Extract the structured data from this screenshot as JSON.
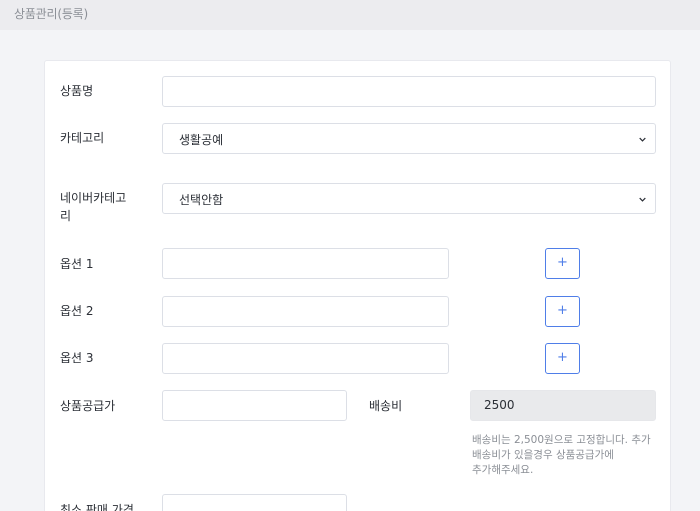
{
  "header": {
    "title": "상품관리(등록)"
  },
  "form": {
    "product_name": {
      "label": "상품명",
      "value": ""
    },
    "category": {
      "label": "카테고리",
      "selected": "생활공예"
    },
    "naver_category": {
      "label_line1": "네이버카테고",
      "label_line2": "리",
      "selected": "선택안함"
    },
    "options": [
      {
        "label": "옵션 1",
        "value": "",
        "add_label": "+"
      },
      {
        "label": "옵션 2",
        "value": "",
        "add_label": "+"
      },
      {
        "label": "옵션 3",
        "value": "",
        "add_label": "+"
      }
    ],
    "supply_price": {
      "label": "상품공급가",
      "value": ""
    },
    "shipping": {
      "label": "배송비",
      "value": "2500",
      "help_lines": [
        "배송비는 2,500원으로 고정합니다. 추가",
        "배송비가 있을경우 상품공급가에",
        "추가해주세요."
      ]
    },
    "min_price": {
      "label": "최소 판매 가격",
      "value": ""
    }
  }
}
